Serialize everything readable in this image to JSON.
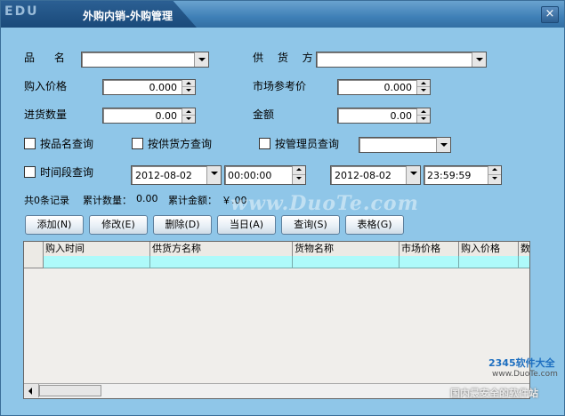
{
  "window": {
    "logo_text": "EDU",
    "title": "外购内销-外购管理",
    "close_symbol": "×"
  },
  "form": {
    "product_label": "品  名",
    "product_value": "",
    "supplier_label": "供 货 方",
    "supplier_value": "",
    "purchase_price_label": "购入价格",
    "purchase_price_value": "0.000",
    "market_price_label": "市场参考价",
    "market_price_value": "0.000",
    "quantity_label": "进货数量",
    "quantity_value": "0.00",
    "amount_label": "金额",
    "amount_value": "0.00"
  },
  "filters": {
    "by_product": "按品名查询",
    "by_supplier": "按供货方查询",
    "by_manager": "按管理员查询",
    "manager_value": "",
    "by_period": "时间段查询",
    "start_date": "2012-08-02",
    "start_time": "00:00:00",
    "end_date": "2012-08-02",
    "end_time": "23:59:59"
  },
  "summary": {
    "records": "共0条记录",
    "total_qty_label": "累计数量：",
    "total_qty": "0.00",
    "total_amount_label": "累计金额：",
    "total_amount": "￥.00"
  },
  "toolbar": {
    "add": "添加(N)",
    "edit": "修改(E)",
    "delete": "删除(D)",
    "today": "当日(A)",
    "query": "查询(S)",
    "table": "表格(G)"
  },
  "table": {
    "columns": [
      "购入时间",
      "供货方名称",
      "货物名称",
      "市场价格",
      "购入价格",
      "数"
    ]
  },
  "watermark": {
    "site": "www.DuoTe.com",
    "brand": "2345软件大全",
    "brand_url": "www.DuoTe.com",
    "slogan": "国内最安全的软件站"
  },
  "colors": {
    "background": "#8fc6e8",
    "title_bar": "#3f80b7",
    "grid_row": "#aefafa"
  }
}
